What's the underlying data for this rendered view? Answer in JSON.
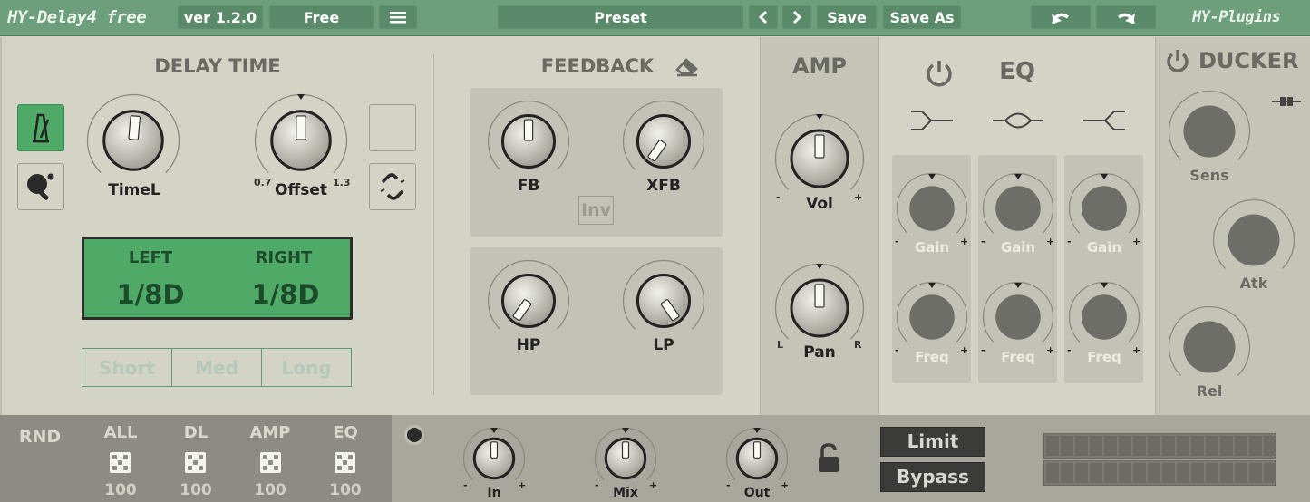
{
  "topbar": {
    "logo": "HY-Delay4 free",
    "version": "ver 1.2.0",
    "tier": "Free",
    "menu_icon": "hamburger-menu-icon",
    "preset": "Preset",
    "save": "Save",
    "save_as": "Save As",
    "brand": "HY-Plugins"
  },
  "delay": {
    "title": "DELAY TIME",
    "knob_time": "TimeL",
    "knob_offset": "Offset",
    "offset_min": "0.7",
    "offset_max": "1.3",
    "display": {
      "left_label": "LEFT",
      "right_label": "RIGHT",
      "left_value": "1/8D",
      "right_value": "1/8D"
    },
    "ranges": [
      "Short",
      "Med",
      "Long"
    ]
  },
  "feedback": {
    "title": "FEEDBACK",
    "fb": "FB",
    "xfb": "XFB",
    "inv": "Inv",
    "hp": "HP",
    "lp": "LP"
  },
  "amp": {
    "title": "AMP",
    "vol": "Vol",
    "pan": "Pan",
    "minus": "-",
    "plus": "+",
    "pan_left": "L",
    "pan_right": "R"
  },
  "eq": {
    "title": "EQ",
    "gain": "Gain",
    "freq": "Freq"
  },
  "ducker": {
    "title": "DUCKER",
    "sens": "Sens",
    "atk": "Atk",
    "rel": "Rel"
  },
  "rnd": {
    "title": "RND",
    "groups": [
      {
        "label": "ALL",
        "value": "100"
      },
      {
        "label": "DL",
        "value": "100"
      },
      {
        "label": "AMP",
        "value": "100"
      },
      {
        "label": "EQ",
        "value": "100"
      }
    ]
  },
  "io": {
    "in": "In",
    "mix": "Mix",
    "out": "Out",
    "limit": "Limit",
    "bypass": "Bypass"
  },
  "colors": {
    "accent_green": "#6d9f7d",
    "display_green": "#4faa68",
    "panel": "#d3d3c6",
    "panel_dark": "#c4c4b7"
  }
}
